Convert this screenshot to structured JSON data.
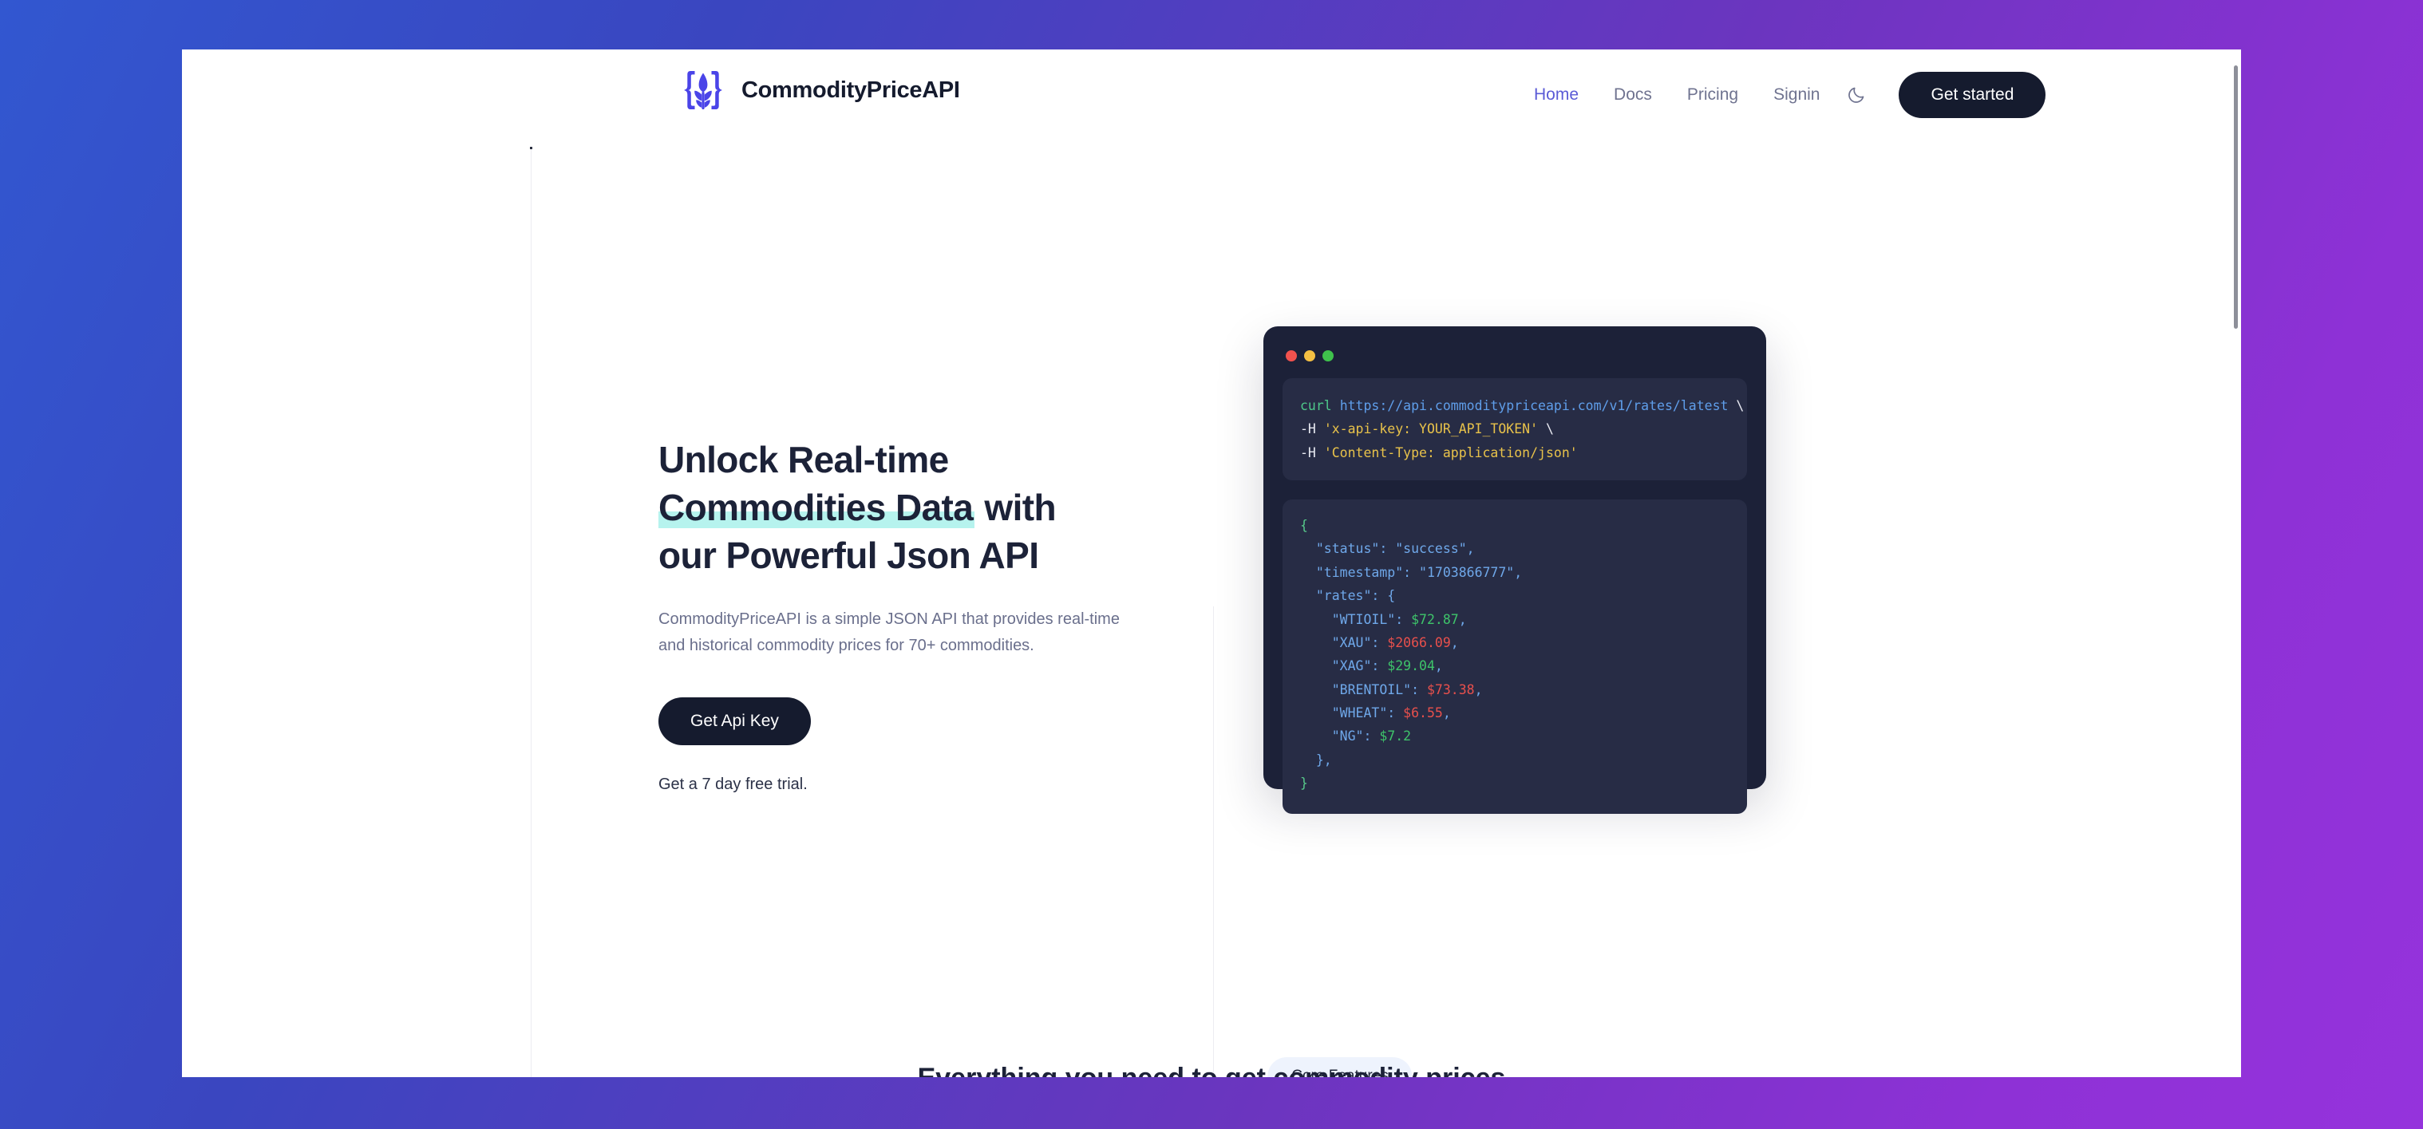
{
  "brand": {
    "name": "CommodityPriceAPI",
    "logo_icon": "wheat-braces-logo",
    "accent_color": "#4a44e8"
  },
  "nav": {
    "links": [
      {
        "label": "Home",
        "active": true
      },
      {
        "label": "Docs",
        "active": false
      },
      {
        "label": "Pricing",
        "active": false
      },
      {
        "label": "Signin",
        "active": false
      }
    ],
    "theme_toggle_icon": "moon-icon",
    "cta_label": "Get started"
  },
  "hero": {
    "title_line1": "Unlock Real-time",
    "title_highlight": "Commodities Data",
    "title_after_highlight": " with",
    "title_line3": "our Powerful Json API",
    "highlight_color": "#b6f3ee",
    "subtitle": "CommodityPriceAPI is a simple JSON API that provides real-time and historical commodity prices for 70+ commodities.",
    "cta_label": "Get Api Key",
    "trial_note": "Get a 7 day free trial."
  },
  "terminal": {
    "dots": [
      "close",
      "minimize",
      "maximize"
    ],
    "dot_colors": {
      "close": "#f2524e",
      "minimize": "#f5c043",
      "maximize": "#3fc24c"
    },
    "request": {
      "command": "curl",
      "url": "https://api.commoditypriceapi.com/v1/rates/latest",
      "continuation": "\\",
      "headers": [
        {
          "flag": "-H",
          "value": "'x-api-key: YOUR_API_TOKEN'",
          "continuation": "\\"
        },
        {
          "flag": "-H",
          "value": "'Content-Type: application/json'",
          "continuation": ""
        }
      ]
    },
    "response": {
      "open_brace": "{",
      "status_key": "\"status\"",
      "status_value": "\"success\"",
      "timestamp_key": "\"timestamp\"",
      "timestamp_value": "\"1703866777\"",
      "rates_key": "\"rates\"",
      "rates": [
        {
          "key": "\"WTIOIL\"",
          "value": "$72.87",
          "color": "green",
          "comma": ","
        },
        {
          "key": "\"XAU\"",
          "value": "$2066.09",
          "color": "red",
          "comma": ","
        },
        {
          "key": "\"XAG\"",
          "value": "$29.04",
          "color": "green",
          "comma": ","
        },
        {
          "key": "\"BRENTOIL\"",
          "value": "$73.38",
          "color": "red",
          "comma": ","
        },
        {
          "key": "\"WHEAT\"",
          "value": "$6.55",
          "color": "red",
          "comma": ","
        },
        {
          "key": "\"NG\"",
          "value": "$7.2",
          "color": "green",
          "comma": ""
        }
      ],
      "close_inner": "},",
      "close_brace": "}"
    }
  },
  "sections": {
    "core_features_badge": "Core Features",
    "clipped_heading": "Everything you need to get commodity prices"
  },
  "colors": {
    "page_background": "#ffffff",
    "desktop_gradient_start": "#3257d0",
    "desktop_gradient_end": "#9533dc",
    "dark": "#151b2e",
    "nav_active": "#5b5bd6",
    "muted_text": "#6a6f8c",
    "terminal_bg": "#1c2138",
    "code_pane_bg": "#272c45"
  }
}
